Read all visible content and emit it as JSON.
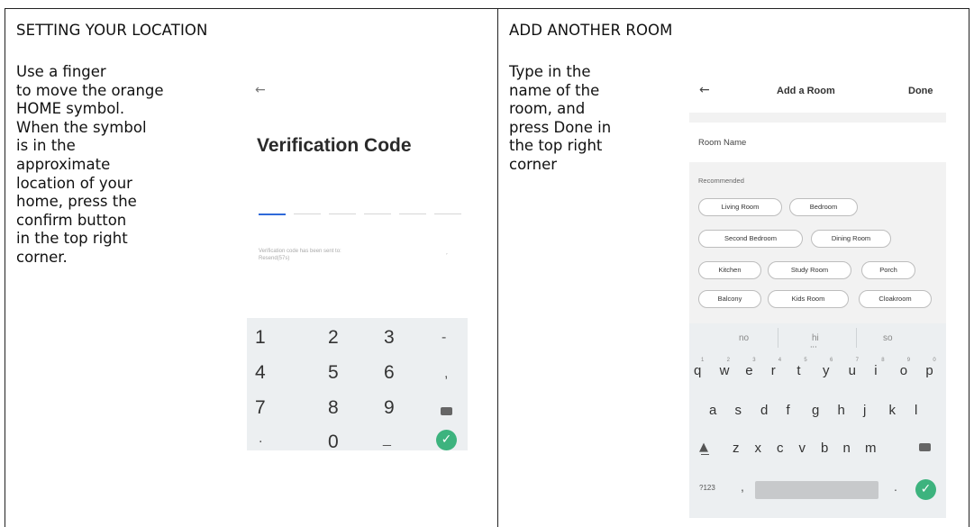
{
  "left": {
    "title": "SETTING YOUR LOCATION",
    "instructions": "Use a finger\nto move the orange\nHOME symbol.\nWhen the symbol\nis in the\napproximate\nlocation of your\nhome, press the\nconfirm button\nin the top right\ncorner.",
    "phone": {
      "back_icon": "←",
      "heading": "Verification Code",
      "sent_text": "Verification code has been sent to:\nResend(57s)",
      "sent_suffix": ",",
      "keys": [
        "1",
        "2",
        "3",
        "-",
        "4",
        "5",
        "6",
        ",",
        "7",
        "8",
        "9",
        ".",
        "0",
        "_"
      ]
    }
  },
  "right": {
    "title": "ADD ANOTHER ROOM",
    "instructions": "Type in the\nname of the\nroom, and\npress Done in\nthe top right\ncorner",
    "phone": {
      "back_icon": "←",
      "header_title": "Add a Room",
      "done_label": "Done",
      "room_name_label": "Room Name",
      "recommended_label": "Recommended",
      "chips": [
        "Living Room",
        "Bedroom",
        "Second Bedroom",
        "Dining Room",
        "Kitchen",
        "Study Room",
        "Porch",
        "Balcony",
        "Kids Room",
        "Cloakroom"
      ],
      "suggestions": [
        "no",
        "hi",
        "so"
      ],
      "row1": [
        "q",
        "w",
        "e",
        "r",
        "t",
        "y",
        "u",
        "i",
        "o",
        "p"
      ],
      "row1_nums": [
        "1",
        "2",
        "3",
        "4",
        "5",
        "6",
        "7",
        "8",
        "9",
        "0"
      ],
      "row2": [
        "a",
        "s",
        "d",
        "f",
        "g",
        "h",
        "j",
        "k",
        "l"
      ],
      "row3": [
        "z",
        "x",
        "c",
        "v",
        "b",
        "n",
        "m"
      ],
      "symbols_key": "?123",
      "comma_key": ",",
      "period_key": "."
    }
  },
  "colors": {
    "border": "#222222",
    "accent_blue": "#2f6ad9",
    "confirm_green": "#3db37e",
    "keyboard_bg": "#eceff1"
  }
}
